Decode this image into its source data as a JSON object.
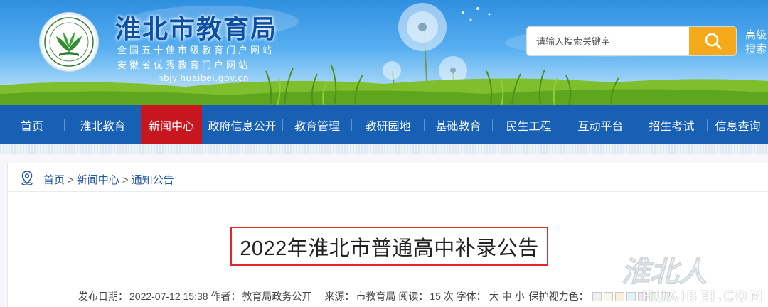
{
  "header": {
    "title": "淮北市教育局",
    "subtitle_1": "全国五十佳市级教育门户网站",
    "subtitle_2": "安徽省优秀教育门户网站",
    "domain": "hbjy.huaibei.gov.cn",
    "logo_icon": "education-bureau-seal"
  },
  "search": {
    "placeholder": "请输入搜索关键字",
    "button_icon": "search-icon",
    "advanced_label": "高级搜索"
  },
  "nav": {
    "active_index": 2,
    "items": [
      {
        "label": "首页"
      },
      {
        "label": "淮北教育"
      },
      {
        "label": "新闻中心"
      },
      {
        "label": "政府信息公开"
      },
      {
        "label": "教育管理"
      },
      {
        "label": "教研园地"
      },
      {
        "label": "基础教育"
      },
      {
        "label": "民生工程"
      },
      {
        "label": "互动平台"
      },
      {
        "label": "招生考试"
      },
      {
        "label": "信息查询"
      }
    ]
  },
  "breadcrumb": {
    "icon": "location-pin-icon",
    "items": [
      "首页",
      "新闻中心",
      "通知公告"
    ],
    "separator": ">"
  },
  "article": {
    "title": "2022年淮北市普通高中补录公告",
    "publish_label": "发布日期：",
    "publish_date": "2022-07-12 15:38",
    "author_label": "作者：",
    "author": "教育局政务公开",
    "source_label": "来源：",
    "source": "市教育局",
    "views_label": "阅读：",
    "views": "15",
    "views_unit": "次",
    "font_label": "字体：",
    "font_large": "大",
    "font_medium": "中",
    "font_small": "小",
    "eye_care_label": "保护视力色：",
    "eye_care_colors": [
      "#f0f0f0",
      "#f4f8e4",
      "#f8f0d8",
      "#e4f1f8",
      "#f2e6f2",
      "#e6f4e6",
      "#f0f0f0"
    ]
  },
  "watermark": {
    "text": "淮北人",
    "domain": "HUAIBEI.COM"
  },
  "colors": {
    "nav_bg": "#1760b4",
    "nav_active": "#c8161e",
    "search_button": "#f6a91b",
    "title_border": "#e8242b",
    "link": "#2458a0"
  }
}
